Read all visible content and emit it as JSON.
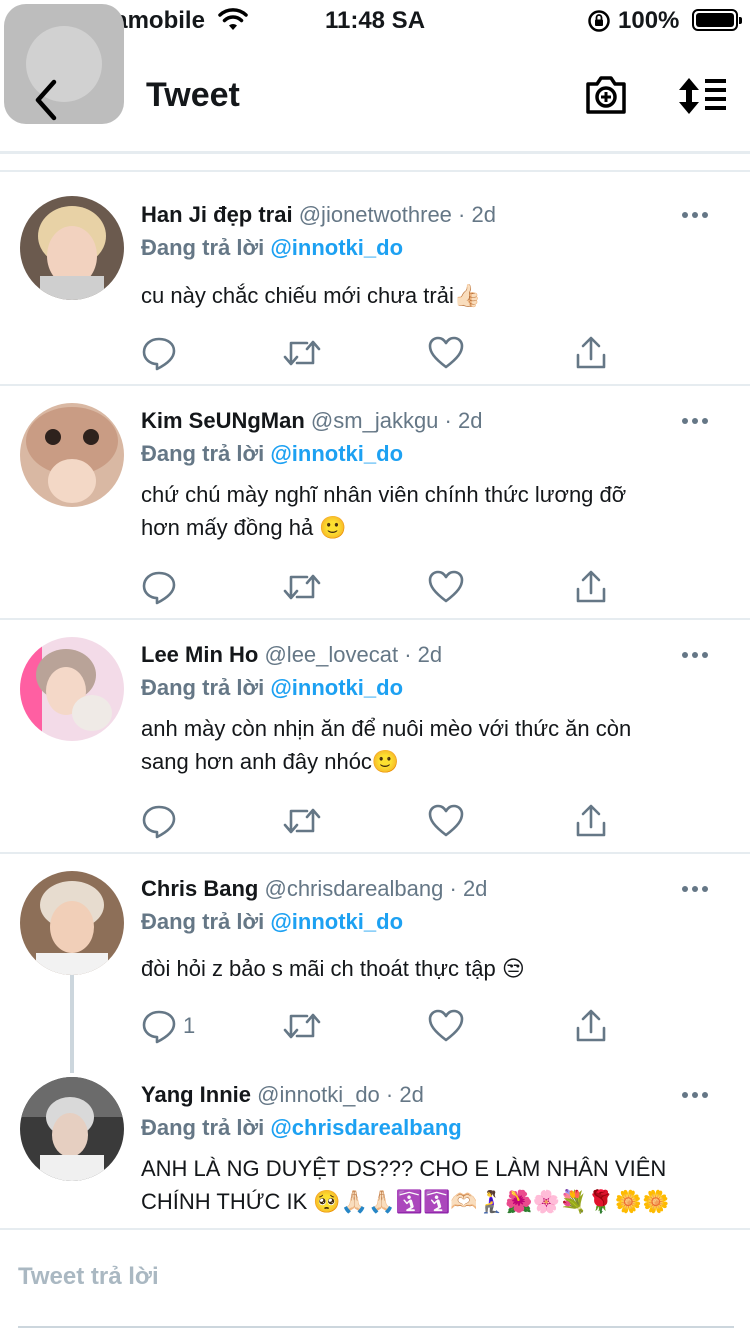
{
  "status_bar": {
    "carrier": "Vietnamobile",
    "time": "11:48 SA",
    "battery": "100%"
  },
  "header": {
    "title": "Tweet"
  },
  "replies": [
    {
      "name": "Han Ji đẹp trai",
      "handle": "@jionetwothree",
      "age": "· 2d",
      "replying_prefix": "Đang trả lời",
      "replying_to": "@innotki_do",
      "text_lines": [
        "cu này chắc chiếu mới chưa trải👍🏻"
      ],
      "reply_count": "",
      "avatar_colors": [
        "#d8b99a",
        "#6b5a4e"
      ]
    },
    {
      "name": "Kim SeUNgMan",
      "handle": "@sm_jakkgu",
      "age": "· 2d",
      "replying_prefix": "Đang trả lời",
      "replying_to": "@innotki_do",
      "text_lines": [
        "chứ chú mày nghĩ nhân viên chính thức lương đỡ",
        "hơn mấy đồng hả 🙂"
      ],
      "reply_count": "",
      "avatar_colors": [
        "#e8c4a8",
        "#5b4033"
      ]
    },
    {
      "name": "Lee Min Ho",
      "handle": "@lee_lovecat",
      "age": "· 2d",
      "replying_prefix": "Đang trả lời",
      "replying_to": "@innotki_do",
      "text_lines": [
        "anh mày còn nhịn ăn để nuôi mèo với thức ăn còn",
        "sang hơn anh đây nhóc🙂"
      ],
      "reply_count": "",
      "avatar_colors": [
        "#f1d6e4",
        "#b7a59a"
      ]
    },
    {
      "name": "Chris Bang",
      "handle": "@chrisdarealbang",
      "age": "· 2d",
      "replying_prefix": "Đang trả lời",
      "replying_to": "@innotki_do",
      "text_lines": [
        "đòi hỏi z bảo s mãi ch thoát thực tập 😒"
      ],
      "reply_count": "1",
      "avatar_colors": [
        "#c9a98f",
        "#3d3430"
      ]
    },
    {
      "name": "Yang Innie",
      "handle": "@innotki_do",
      "age": "· 2d",
      "replying_prefix": "Đang trả lời",
      "replying_to": "@chrisdarealbang",
      "text_lines": [
        "ANH LÀ NG DUYỆT DS??? CHO E LÀM NHÂN VIÊN",
        "CHÍNH THỨC IK 🥺🙏🏻🙏🏻🛐🛐🫶🏻🧎‍♀️🌺🌸💐🌹🌼🌼"
      ],
      "reply_count": "",
      "avatar_colors": [
        "#8a8a8a",
        "#2b2b2b"
      ]
    }
  ],
  "compose": {
    "placeholder": "Tweet trả lời"
  },
  "colors": {
    "accent": "#1da1f2",
    "secondary_text": "#657786",
    "divider": "#e6ecf0"
  }
}
